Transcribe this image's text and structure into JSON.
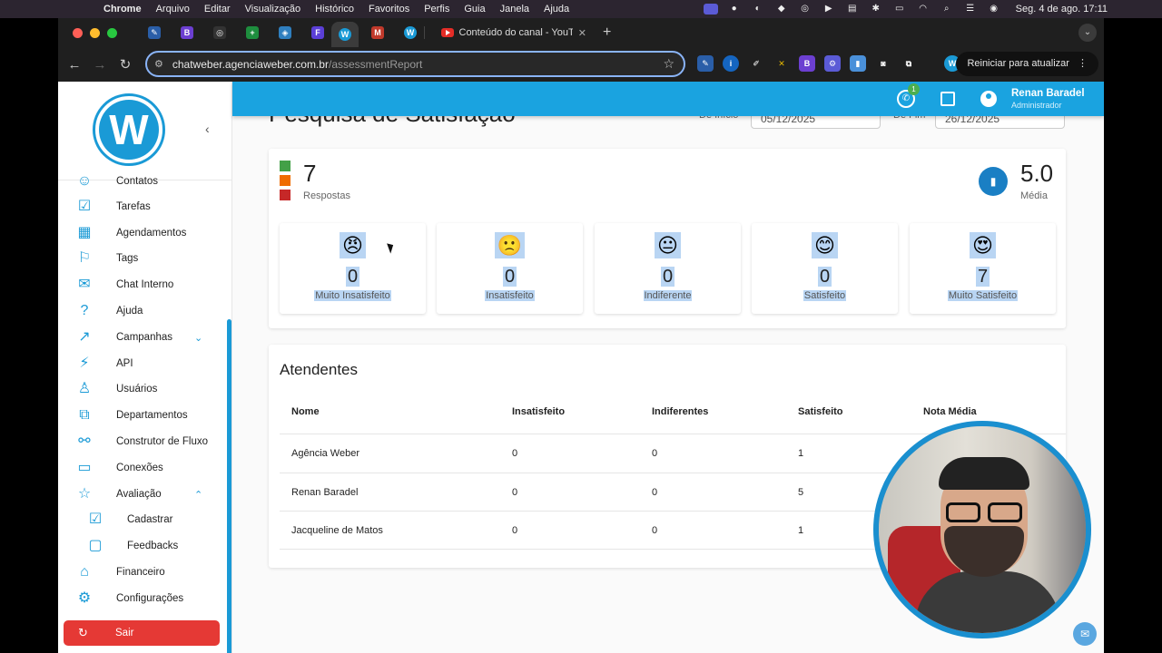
{
  "mac_menubar": {
    "app": "Chrome",
    "menus": [
      "Arquivo",
      "Editar",
      "Visualização",
      "Histórico",
      "Favoritos",
      "Perfis",
      "Guia",
      "Janela",
      "Ajuda"
    ],
    "clock": "Seg. 4 de ago.  17:11"
  },
  "browser": {
    "active_tab_title": "Conteúdo do canal - YouTube",
    "url_host": "chatweber.agenciaweber.com.br",
    "url_path": "/assessmentReport",
    "update_button": "Reiniciar para atualizar"
  },
  "sidebar": {
    "logo_letter": "W",
    "items": [
      {
        "label": "Contatos",
        "icon": "contacts-icon"
      },
      {
        "label": "Tarefas",
        "icon": "tasks-icon"
      },
      {
        "label": "Agendamentos",
        "icon": "calendar-icon"
      },
      {
        "label": "Tags",
        "icon": "bookmark-icon"
      },
      {
        "label": "Chat Interno",
        "icon": "chat-icon"
      },
      {
        "label": "Ajuda",
        "icon": "help-icon"
      },
      {
        "label": "Campanhas",
        "icon": "trending-icon"
      },
      {
        "label": "API",
        "icon": "plug-icon"
      },
      {
        "label": "Usuários",
        "icon": "user-add-icon"
      },
      {
        "label": "Departamentos",
        "icon": "departments-icon"
      },
      {
        "label": "Construtor de Fluxo",
        "icon": "flow-icon"
      },
      {
        "label": "Conexões",
        "icon": "monitor-icon"
      },
      {
        "label": "Avaliação",
        "icon": "star-icon"
      },
      {
        "label": "Cadastrar",
        "icon": "clipboard-check-icon"
      },
      {
        "label": "Feedbacks",
        "icon": "message-icon"
      },
      {
        "label": "Financeiro",
        "icon": "bank-icon"
      },
      {
        "label": "Configurações",
        "icon": "gear-icon"
      }
    ],
    "logout": "Sair"
  },
  "header": {
    "whatsapp_badge": "1",
    "user_name": "Renan Baradel",
    "user_role": "Administrador"
  },
  "page": {
    "title": "Pesquisa de Satisfação",
    "date_start_label": "De Início",
    "date_start": "05/12/2025",
    "date_end_label": "De Fim",
    "date_end": "26/12/2025"
  },
  "summary": {
    "responses": "7",
    "responses_label": "Respostas",
    "average": "5.0",
    "average_label": "Média",
    "legend_colors": [
      "#43a047",
      "#ef6c00",
      "#c62828"
    ],
    "ratings": [
      {
        "emoji": "😠",
        "count": "0",
        "label": "Muito Insatisfeito"
      },
      {
        "emoji": "🙁",
        "count": "0",
        "label": "Insatisfeito"
      },
      {
        "emoji": "😐",
        "count": "0",
        "label": "Indiferente"
      },
      {
        "emoji": "😊",
        "count": "0",
        "label": "Satisfeito"
      },
      {
        "emoji": "😍",
        "count": "7",
        "label": "Muito Satisfeito"
      }
    ]
  },
  "agents": {
    "title": "Atendentes",
    "columns": [
      "Nome",
      "Insatisfeito",
      "Indiferentes",
      "Satisfeito",
      "Nota Média"
    ],
    "rows": [
      [
        "Agência Weber",
        "0",
        "0",
        "1"
      ],
      [
        "Renan Baradel",
        "0",
        "0",
        "5"
      ],
      [
        "Jacqueline de Matos",
        "0",
        "0",
        "1"
      ]
    ]
  }
}
